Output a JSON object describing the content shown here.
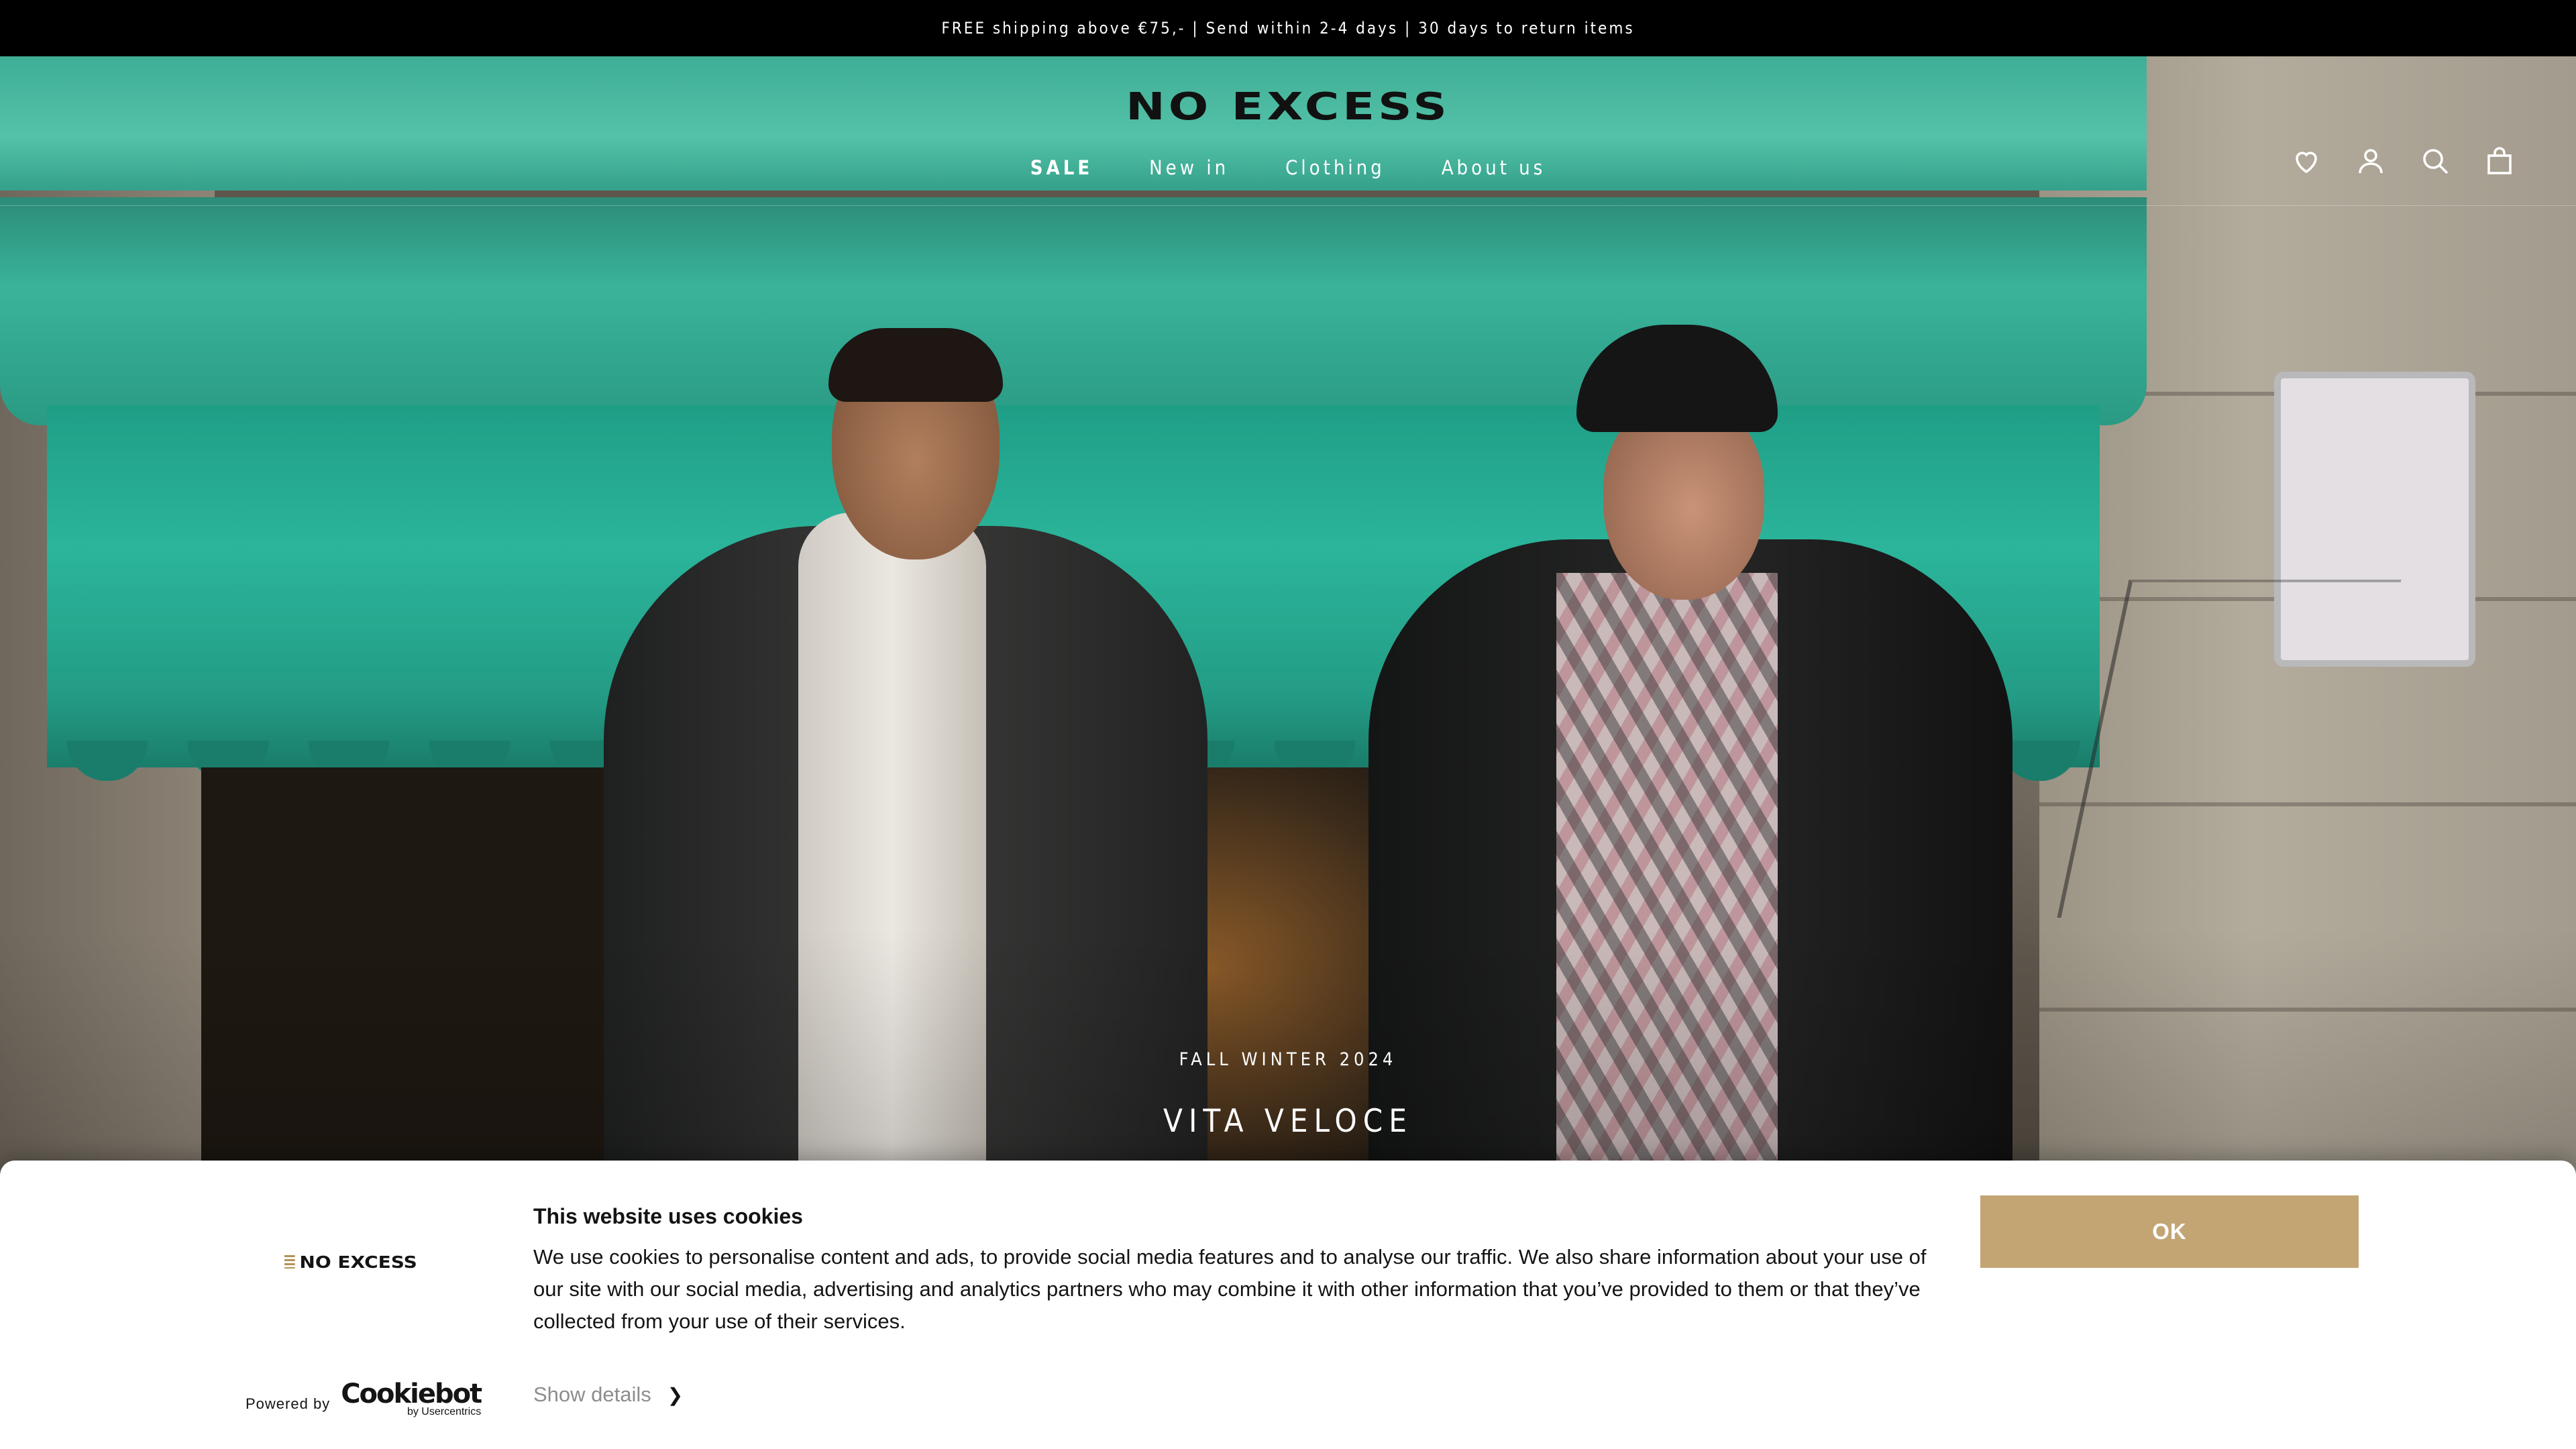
{
  "announcement": {
    "text": "FREE shipping above €75,- | Send within 2-4 days | 30 days to return items"
  },
  "header": {
    "logo": "NO EXCESS",
    "nav": [
      {
        "label": "SALE"
      },
      {
        "label": "New in"
      },
      {
        "label": "Clothing"
      },
      {
        "label": "About us"
      }
    ],
    "icons": [
      "wishlist-heart-icon",
      "account-icon",
      "search-icon",
      "cart-bag-icon"
    ]
  },
  "hero": {
    "subtitle": "FALL WINTER 2024",
    "title": "VITA VELOCE"
  },
  "cookie_banner": {
    "logo": "NO EXCESS",
    "title": "This website uses cookies",
    "body": "We use cookies to personalise content and ads, to provide social media features and to analyse our traffic. We also share information about your use of our site with our social media, advertising and analytics partners who may combine it with other information that you’ve provided to them or that they’ve collected from your use of their services.",
    "ok_label": "OK",
    "powered_by": "Powered by",
    "cookiebot_name": "Cookiebot",
    "cookiebot_sub": "by Usercentrics",
    "show_details": "Show details"
  },
  "colors": {
    "accent": "#c3a574",
    "announce_bg": "#000000",
    "awning": "#2bb59b"
  }
}
